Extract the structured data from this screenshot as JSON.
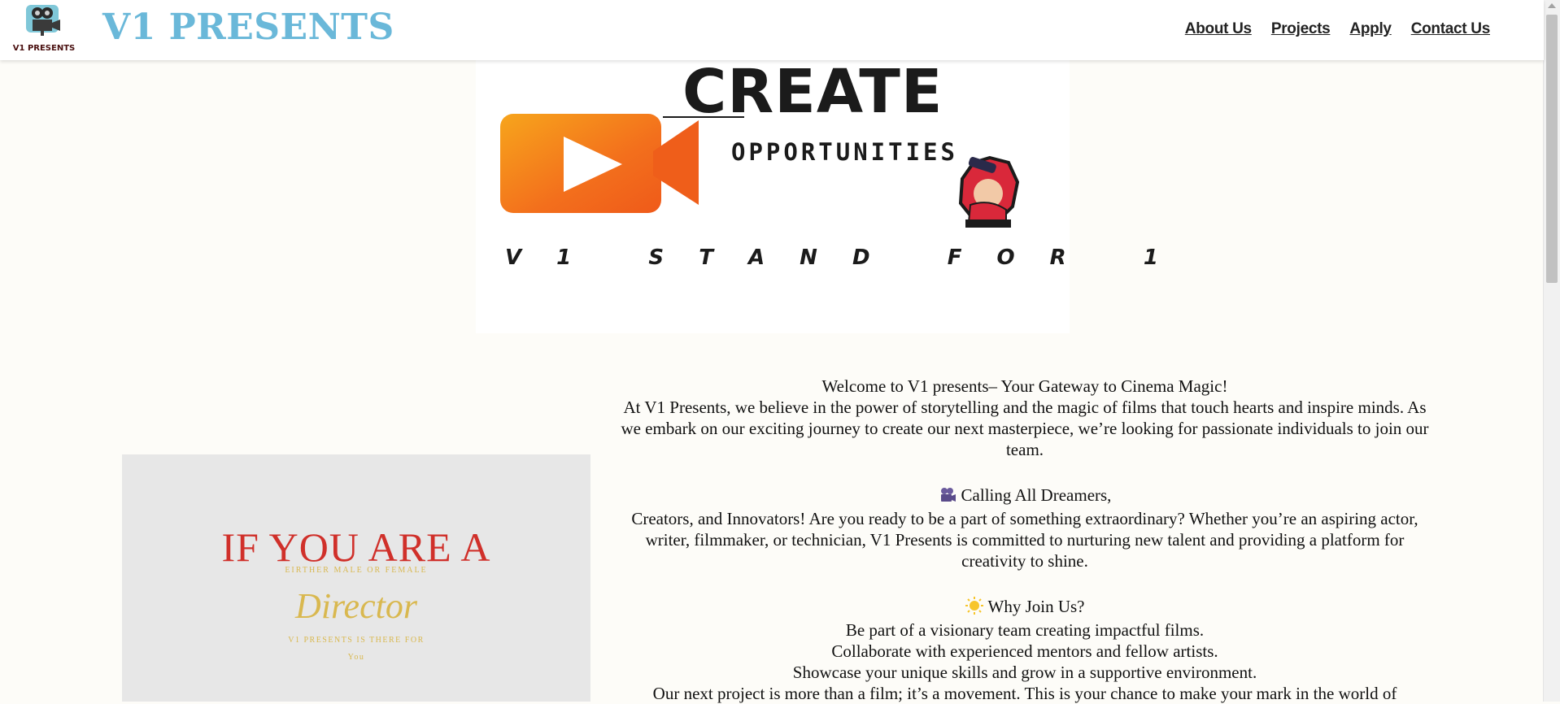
{
  "header": {
    "logo_text": "V1 PRESENTS",
    "brand": "V1 PRESENTS",
    "nav": [
      "About Us",
      "Projects",
      "Apply",
      "Contact Us"
    ]
  },
  "hero": {
    "title": "CREATE",
    "subtitle": "OPPORTUNITIES",
    "tagline": "V 1   S T A N D   F O R   1"
  },
  "poster": {
    "line1": "IF YOU ARE A",
    "line2": "EIRTHER MALE OR FEMALE",
    "line3": "Director",
    "line4": "V1 PRESENTS IS THERE FOR",
    "line5": "You"
  },
  "content": {
    "welcome_title": "Welcome to V1 presents– Your Gateway to Cinema Magic!",
    "welcome_body": "At V1 Presents, we believe in the power of storytelling and the magic of films that touch hearts and inspire minds. As we embark on our exciting journey to create our next masterpiece, we’re looking for passionate individuals to join our team.",
    "calling_title": "Calling All Dreamers,",
    "calling_body": "Creators, and Innovators! Are you ready to be a part of something extraordinary? Whether you’re an aspiring actor, writer, filmmaker, or technician, V1 Presents is committed to nurturing new talent and providing a platform for creativity to shine.",
    "why_title": "Why Join Us?",
    "why_items": [
      "Be part of a visionary team creating impactful films.",
      "Collaborate with experienced mentors and fellow artists.",
      "Showcase your unique skills and grow in a supportive environment."
    ],
    "closing": "Our next project is more than a film; it’s a movement. This is your chance to make your mark in the world of"
  },
  "icons": {
    "camera": "movie-camera-icon",
    "sun": "sun-icon"
  },
  "colors": {
    "brand": "#6ab8d9",
    "background": "#fdfcf8",
    "poster_red": "#d0302a",
    "poster_gold": "#d9b84f"
  }
}
